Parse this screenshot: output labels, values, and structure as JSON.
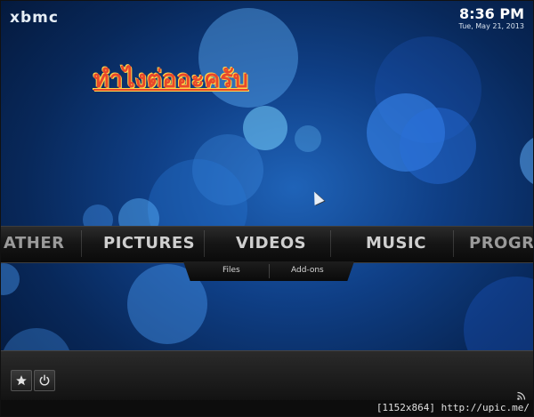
{
  "app": {
    "logo": "xbmc"
  },
  "clock": {
    "time": "8:36 PM",
    "date": "Tue, May 21, 2013"
  },
  "overlay_text": "ทำไงต่ออะครับ",
  "menu": {
    "items": [
      {
        "label": "ATHER"
      },
      {
        "label": "PICTURES"
      },
      {
        "label": "VIDEOS"
      },
      {
        "label": "MUSIC"
      },
      {
        "label": "PROGRA"
      }
    ],
    "selected": "VIDEOS"
  },
  "submenu": {
    "items": [
      {
        "label": "Files"
      },
      {
        "label": "Add-ons"
      }
    ]
  },
  "footer": {
    "buttons": [
      {
        "icon": "star-icon"
      },
      {
        "icon": "power-icon"
      }
    ],
    "rss_icon": "rss-icon"
  },
  "watermark": "[1152x864] http://upic.me/",
  "colors": {
    "overlay_text": "#e8482b",
    "overlay_outline": "#ffd64a",
    "background": "#0f3f86"
  }
}
